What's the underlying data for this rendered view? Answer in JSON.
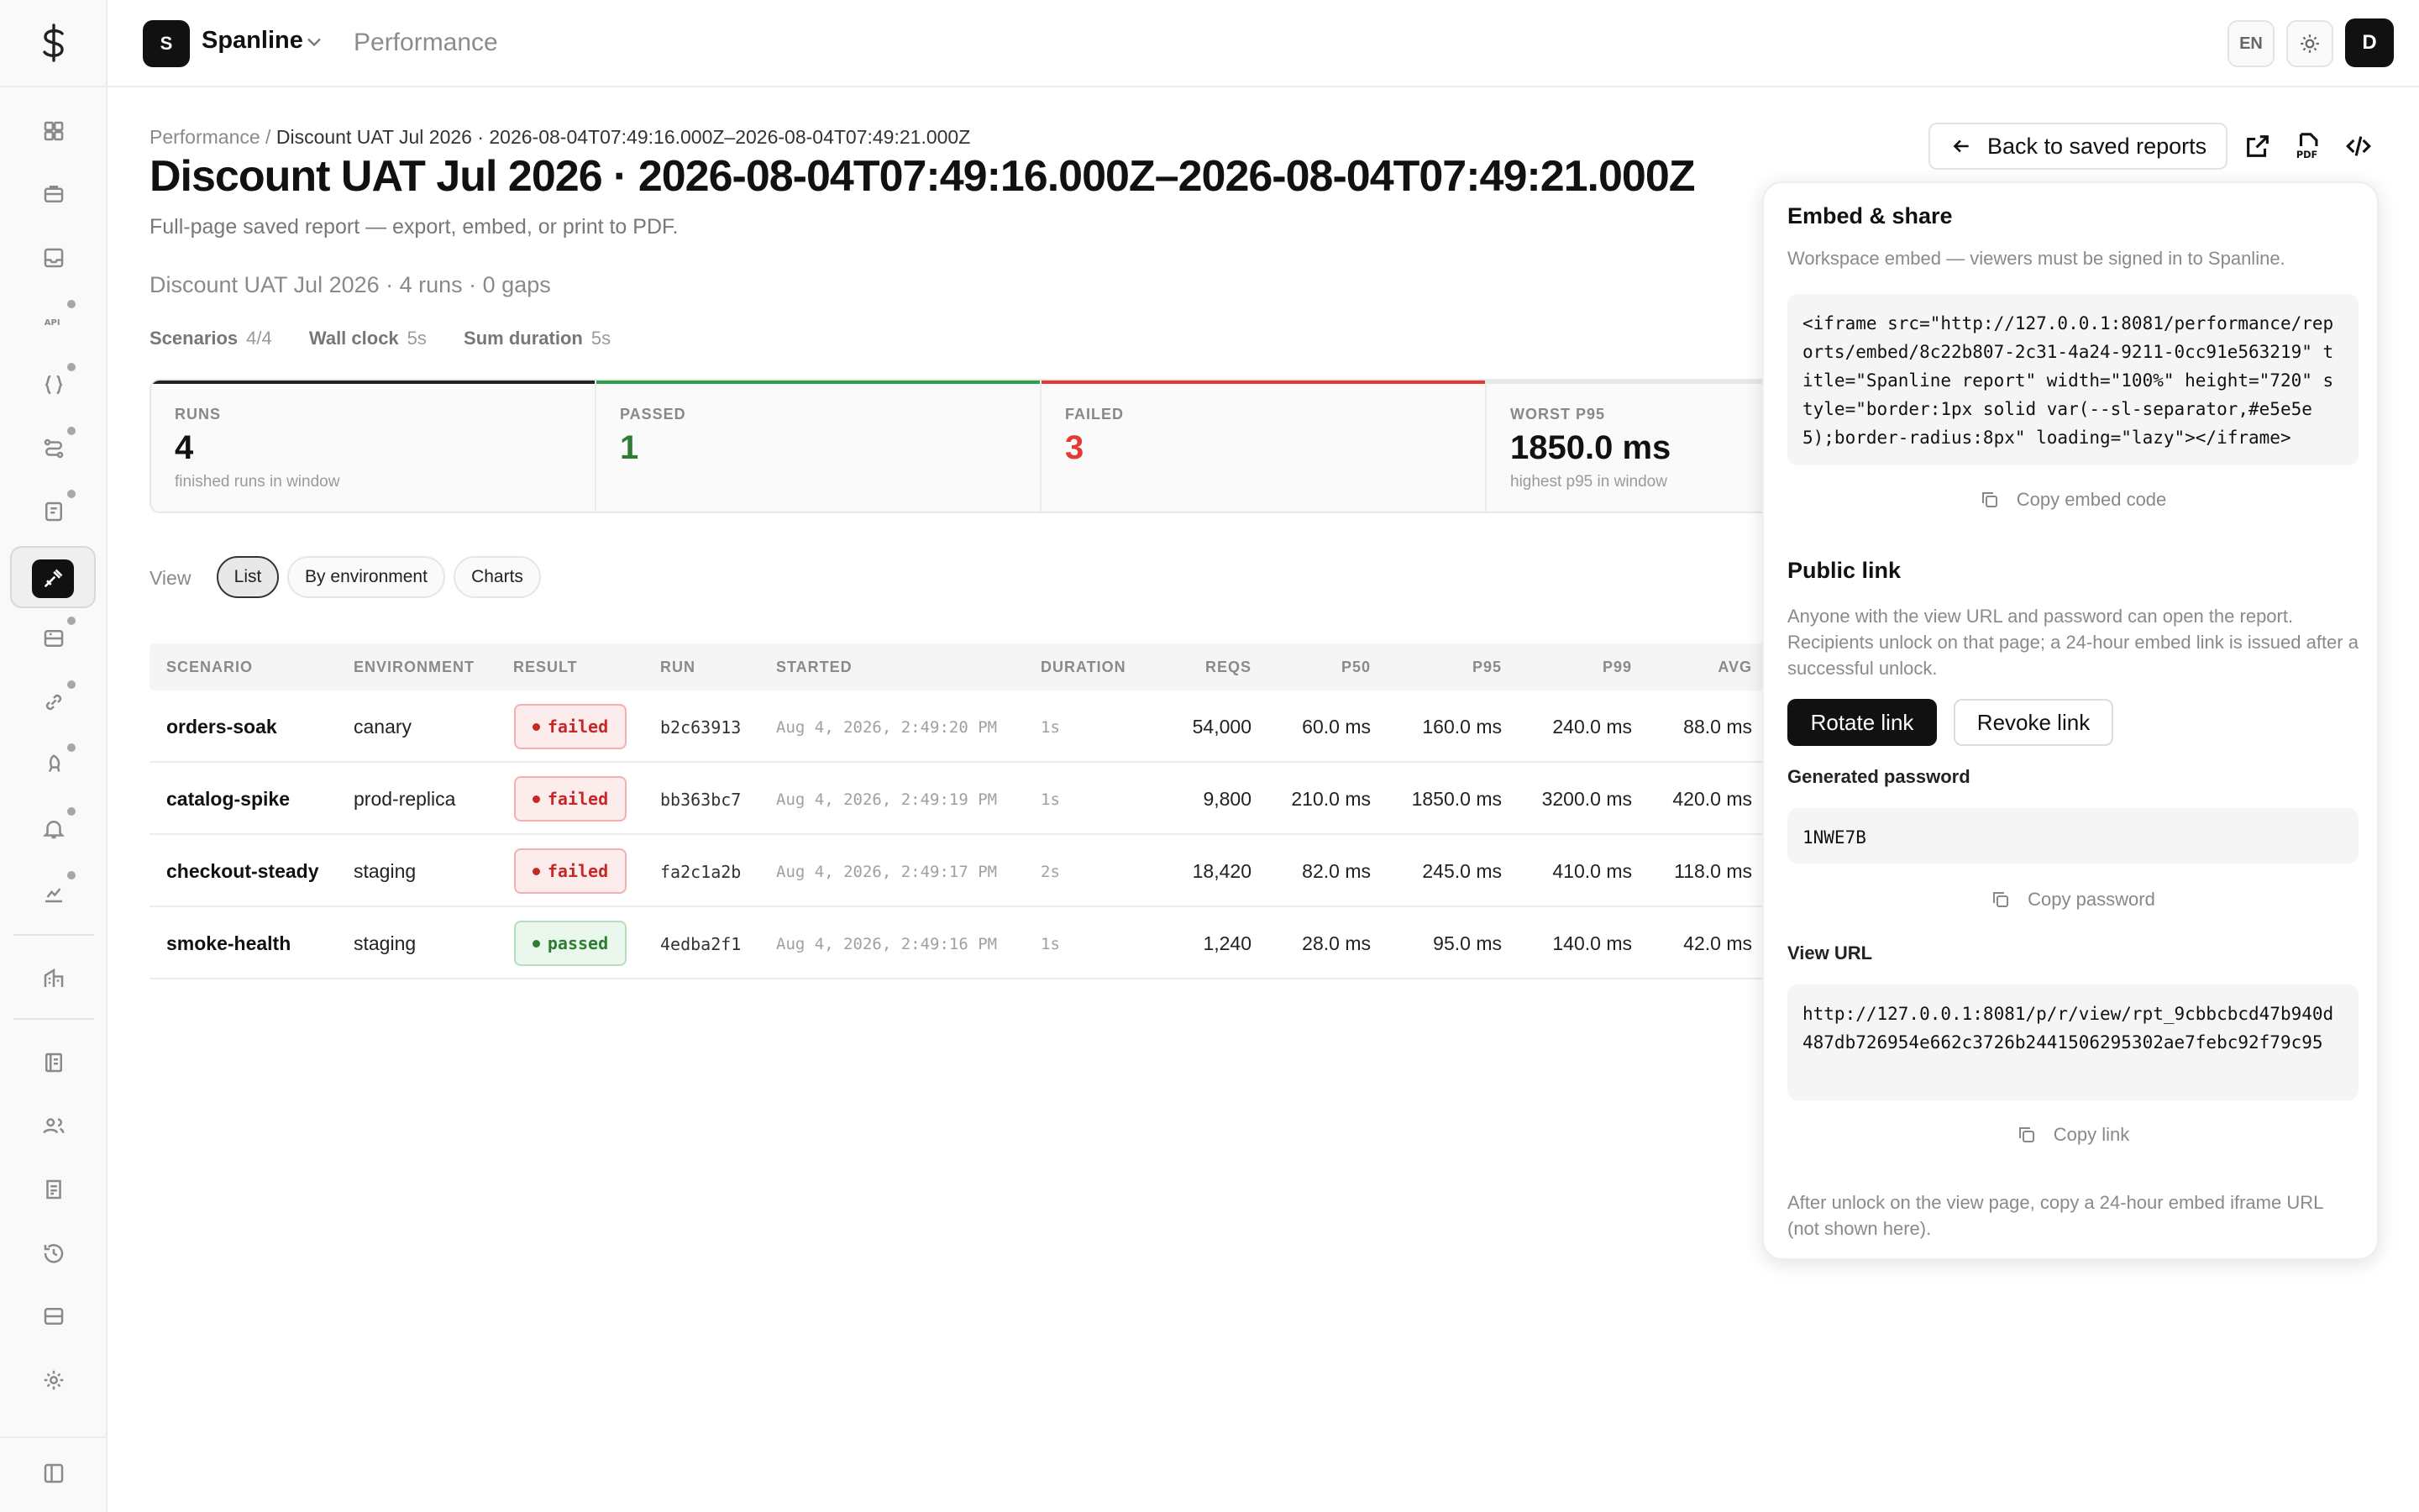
{
  "app": {
    "workspace_initial": "S",
    "workspace_name": "Spanline",
    "section": "Performance",
    "lang": "EN",
    "user_initial": "D"
  },
  "sidebar": {
    "items": [
      {
        "icon": "dashboard-icon",
        "dot": false
      },
      {
        "icon": "briefcase-icon",
        "dot": false
      },
      {
        "icon": "inbox-icon",
        "dot": false
      },
      {
        "icon": "api-icon",
        "dot": true
      },
      {
        "icon": "braces-icon",
        "dot": true
      },
      {
        "icon": "workflow-icon",
        "dot": true
      },
      {
        "icon": "test-doc-icon",
        "dot": true
      },
      {
        "icon": "performance-gauge-icon",
        "dot": false,
        "active": true
      },
      {
        "icon": "server-icon",
        "dot": true
      },
      {
        "icon": "link-icon",
        "dot": true
      },
      {
        "icon": "rocket-icon",
        "dot": true
      },
      {
        "icon": "bell-icon",
        "dot": true
      },
      {
        "icon": "chart-icon",
        "dot": true
      },
      {
        "icon": "building-icon",
        "dot": false
      },
      {
        "icon": "ledger-icon",
        "dot": false
      },
      {
        "icon": "users-icon",
        "dot": false
      },
      {
        "icon": "report-icon",
        "dot": false
      },
      {
        "icon": "history-icon",
        "dot": false
      },
      {
        "icon": "storage-icon",
        "dot": false
      },
      {
        "icon": "settings-icon",
        "dot": false
      }
    ],
    "collapse_icon": "sidebar-collapse-icon"
  },
  "breadcrumb": {
    "parent": "Performance",
    "separator": " / ",
    "current": "Discount UAT Jul 2026 · 2026-08-04T07:49:16.000Z–2026-08-04T07:49:21.000Z"
  },
  "page": {
    "title": "Discount UAT Jul 2026 · 2026-08-04T07:49:16.000Z–2026-08-04T07:49:21.000Z",
    "subtitle": "Full-page saved report — export, embed, or print to PDF.",
    "meta": "Discount UAT Jul 2026 · 4 runs · 0 gaps",
    "stats": [
      {
        "label": "Scenarios",
        "value": "4/4"
      },
      {
        "label": "Wall clock",
        "value": "5s"
      },
      {
        "label": "Sum duration",
        "value": "5s"
      }
    ]
  },
  "kpis": [
    {
      "label": "RUNS",
      "value": "4",
      "hint": "finished runs in window",
      "accent": "#222222",
      "value_color": "#111111"
    },
    {
      "label": "PASSED",
      "value": "1",
      "hint": "",
      "accent": "#2e9e4a",
      "value_color": "#2e7d32"
    },
    {
      "label": "FAILED",
      "value": "3",
      "hint": "",
      "accent": "#e53935",
      "value_color": "#e53935"
    },
    {
      "label": "WORST P95",
      "value": "1850.0 ms",
      "hint": "highest p95 in window",
      "accent": "#e8e8e8",
      "value_color": "#111111"
    }
  ],
  "view": {
    "label": "View",
    "options": [
      "List",
      "By environment",
      "Charts"
    ],
    "selected": "List"
  },
  "table": {
    "columns": [
      "SCENARIO",
      "ENVIRONMENT",
      "RESULT",
      "RUN",
      "STARTED",
      "DURATION",
      "REQS",
      "P50",
      "P95",
      "P99",
      "AVG"
    ],
    "rows": [
      {
        "scenario": "orders-soak",
        "environment": "canary",
        "result": "failed",
        "run": "b2c63913",
        "started": "Aug 4, 2026, 2:49:20 PM",
        "duration": "1s",
        "reqs": "54,000",
        "p50": "60.0 ms",
        "p95": "160.0 ms",
        "p99": "240.0 ms",
        "avg": "88.0 ms"
      },
      {
        "scenario": "catalog-spike",
        "environment": "prod-replica",
        "result": "failed",
        "run": "bb363bc7",
        "started": "Aug 4, 2026, 2:49:19 PM",
        "duration": "1s",
        "reqs": "9,800",
        "p50": "210.0 ms",
        "p95": "1850.0 ms",
        "p99": "3200.0 ms",
        "avg": "420.0 ms"
      },
      {
        "scenario": "checkout-steady",
        "environment": "staging",
        "result": "failed",
        "run": "fa2c1a2b",
        "started": "Aug 4, 2026, 2:49:17 PM",
        "duration": "2s",
        "reqs": "18,420",
        "p50": "82.0 ms",
        "p95": "245.0 ms",
        "p99": "410.0 ms",
        "avg": "118.0 ms"
      },
      {
        "scenario": "smoke-health",
        "environment": "staging",
        "result": "passed",
        "run": "4edba2f1",
        "started": "Aug 4, 2026, 2:49:16 PM",
        "duration": "1s",
        "reqs": "1,240",
        "p50": "28.0 ms",
        "p95": "95.0 ms",
        "p99": "140.0 ms",
        "avg": "42.0 ms"
      }
    ]
  },
  "header_actions": {
    "back_label": "Back to saved reports",
    "icons": [
      "open-external-icon",
      "pdf-icon",
      "code-embed-icon"
    ]
  },
  "share_panel": {
    "title": "Embed & share",
    "embed_note": "Workspace embed — viewers must be signed in to Spanline.",
    "embed_code": "<iframe src=\"http://127.0.0.1:8081/performance/reports/embed/8c22b807-2c31-4a24-9211-0cc91e563219\" title=\"Spanline report\" width=\"100%\" height=\"720\" style=\"border:1px solid var(--sl-separator,#e5e5e5);border-radius:8px\" loading=\"lazy\"></iframe>",
    "copy_embed_label": "Copy embed code",
    "public_title": "Public link",
    "public_note": "Anyone with the view URL and password can open the report. Recipients unlock on that page; a 24-hour embed link is issued after a successful unlock.",
    "rotate_label": "Rotate link",
    "revoke_label": "Revoke link",
    "password_label": "Generated password",
    "password": "1NWE7B",
    "copy_password_label": "Copy password",
    "view_url_label": "View URL",
    "view_url": "http://127.0.0.1:8081/p/r/view/rpt_9cbbcbcd47b940d487db726954e662c3726b2441506295302ae7febc92f79c95",
    "copy_link_label": "Copy link",
    "footer_note": "After unlock on the view page, copy a 24-hour embed iframe URL (not shown here)."
  }
}
